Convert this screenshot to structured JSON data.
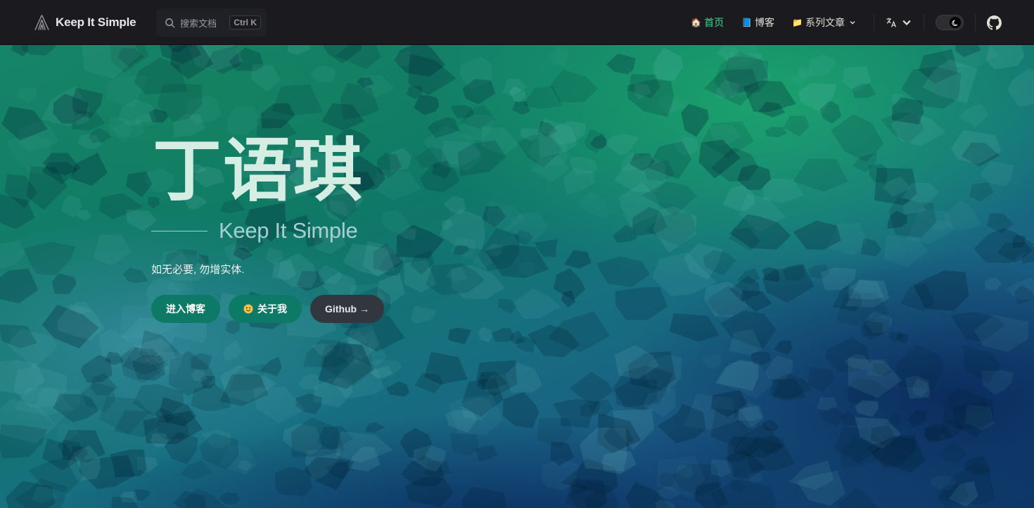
{
  "nav": {
    "brand": "Keep It Simple",
    "search_placeholder": "搜索文档",
    "search_shortcut": "Ctrl K",
    "links": [
      {
        "emoji": "🏠",
        "label": "首页",
        "active": true
      },
      {
        "emoji": "📘",
        "label": "博客",
        "active": false
      },
      {
        "emoji": "📁",
        "label": "系列文章",
        "active": false
      }
    ],
    "active_color": "#3dd68c"
  },
  "hero": {
    "name": "丁语琪",
    "tagline": "Keep It Simple",
    "motto": "如无必要, 勿增实体.",
    "actions": [
      {
        "label": "进入博客",
        "theme": "brand"
      },
      {
        "label": "关于我",
        "theme": "brand",
        "icon": "smile-icon"
      },
      {
        "label": "Github →",
        "theme": "alt"
      }
    ]
  },
  "colors": {
    "nav_bg": "#1b1b1f",
    "brand_button": "#0c7a66",
    "alt_button": "#32363f"
  }
}
